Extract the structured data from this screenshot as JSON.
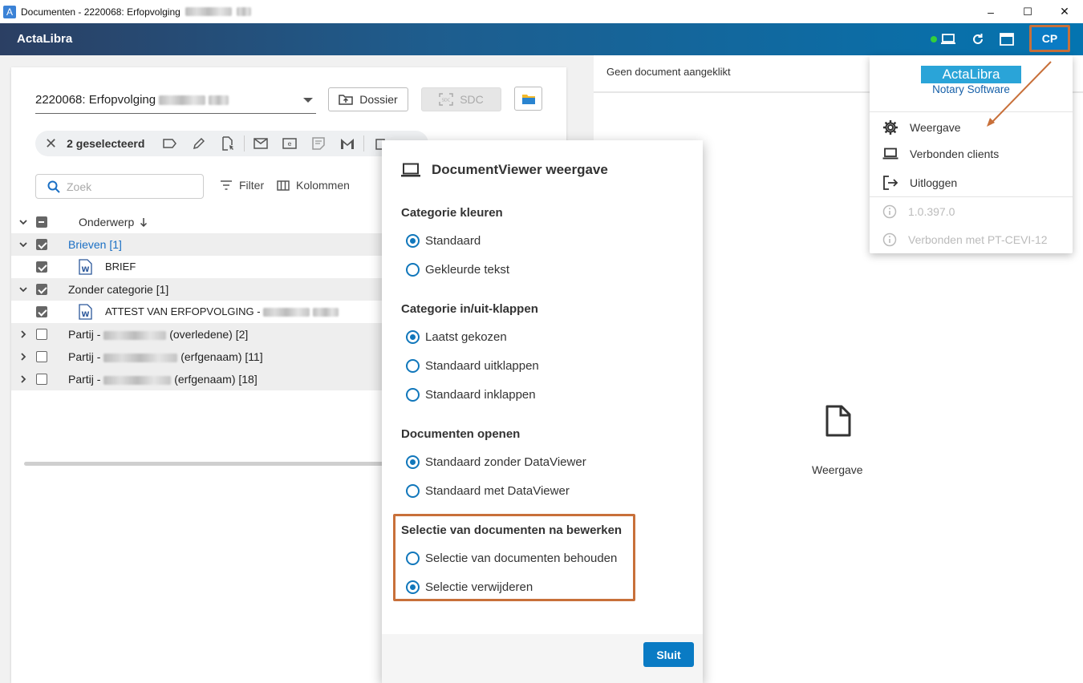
{
  "window": {
    "title": "Documenten - 2220068: Erfopvolging",
    "minimize": "–",
    "maximize": "☐",
    "close": "✕"
  },
  "app": {
    "brand": "ActaLibra",
    "user_initials": "CP"
  },
  "left": {
    "dossier_value": "2220068: Erfopvolging",
    "dossier_button": "Dossier",
    "sdc_button": "SDC",
    "selected_count": "2 geselecteerd",
    "search_placeholder": "Zoek",
    "filter_label": "Filter",
    "columns_label": "Kolommen",
    "column_header": "Onderwerp",
    "rows": [
      {
        "label": "Brieven [1]"
      },
      {
        "label": "BRIEF"
      },
      {
        "label": "Zonder categorie [1]"
      },
      {
        "label": "ATTEST VAN ERFOPVOLGING -"
      },
      {
        "prefix": "Partij -",
        "suffix": "(overledene) [2]"
      },
      {
        "prefix": "Partij -",
        "suffix": "(erfgenaam) [11]"
      },
      {
        "prefix": "Partij -",
        "suffix": "(erfgenaam) [18]"
      }
    ]
  },
  "viewer": {
    "header": "Geen document aangeklikt",
    "empty_label": "Weergave"
  },
  "dialog": {
    "title": "DocumentViewer weergave",
    "sections": [
      {
        "title": "Categorie kleuren",
        "options": [
          "Standaard",
          "Gekleurde tekst"
        ],
        "selected": 0
      },
      {
        "title": "Categorie in/uit-klappen",
        "options": [
          "Laatst gekozen",
          "Standaard uitklappen",
          "Standaard inklappen"
        ],
        "selected": 0
      },
      {
        "title": "Documenten openen",
        "options": [
          "Standaard zonder DataViewer",
          "Standaard met DataViewer"
        ],
        "selected": 0
      },
      {
        "title": "Selectie van documenten na bewerken",
        "options": [
          "Selectie van documenten behouden",
          "Selectie verwijderen"
        ],
        "selected": 1
      }
    ],
    "close_button": "Sluit"
  },
  "menu": {
    "logo_top": "ActaLibra",
    "logo_bottom": "Notary Software",
    "items": [
      "Weergave",
      "Verbonden clients",
      "Uitloggen"
    ],
    "version": "1.0.397.0",
    "connected": "Verbonden met PT-CEVI-12"
  },
  "colors": {
    "accent": "#0a7bc4",
    "highlight": "#c8703a",
    "status": "#33d03a"
  }
}
